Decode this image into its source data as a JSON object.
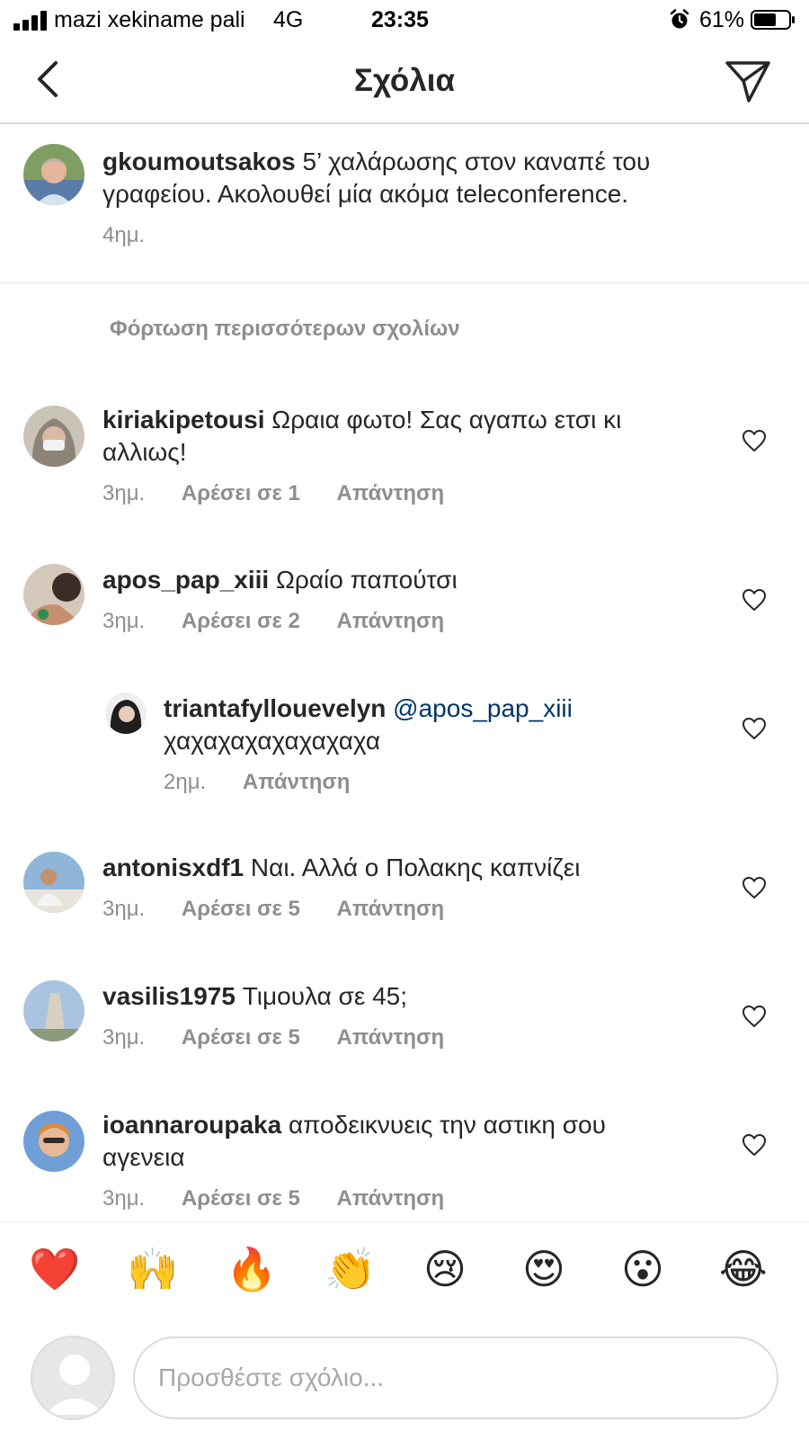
{
  "status_bar": {
    "carrier": "mazi xekiname pali",
    "network": "4G",
    "time": "23:35",
    "battery": "61%"
  },
  "header": {
    "title": "Σχόλια"
  },
  "caption": {
    "username": "gkoumoutsakos",
    "text_line1": " 5’  χαλάρωσης στον καναπέ του",
    "text_line2": "γραφείου. Ακολουθεί μία ακόμα teleconference.",
    "time": "4ημ."
  },
  "load_more": "Φόρτωση περισσότερων σχολίων",
  "comments": [
    {
      "username": "kiriakipetousi",
      "text_line1": " Ωραια φωτο!  Σας αγαπω ετσι κι",
      "text_line2": "αλλιως!",
      "time": "3ημ.",
      "likes": "Αρέσει σε 1",
      "reply": "Απάντηση"
    },
    {
      "username": "apos_pap_xiii",
      "text_line1": " Ωραίο παπούτσι",
      "time": "3ημ.",
      "likes": "Αρέσει σε 2",
      "reply": "Απάντηση"
    },
    {
      "username": "triantafyllouevelyn",
      "mention": " @apos_pap_xiii",
      "text_line2": "χαχαχαχαχαχαχαχα",
      "time": "2ημ.",
      "reply": "Απάντηση"
    },
    {
      "username": "antonisxdf1",
      "text_line1": " Ναι. Αλλά ο Πολακης καπνίζει",
      "time": "3ημ.",
      "likes": "Αρέσει σε 5",
      "reply": "Απάντηση"
    },
    {
      "username": "vasilis1975",
      "text_line1": " Τιμουλα σε 45;",
      "time": "3ημ.",
      "likes": "Αρέσει σε 5",
      "reply": "Απάντηση"
    },
    {
      "username": "ioannaroupaka",
      "text_line1": " αποδεικνυεις την αστικη σου",
      "text_line2": "αγενεια",
      "time": "3ημ.",
      "likes": "Αρέσει σε 5",
      "reply": "Απάντηση"
    }
  ],
  "emoji_bar": [
    "❤️",
    "🙌",
    "🔥",
    "👏",
    "😢",
    "😍",
    "😮",
    "😂"
  ],
  "input": {
    "placeholder": "Προσθέστε σχόλιο..."
  },
  "colors": {
    "text": "#262626",
    "meta": "#8e8e8e",
    "mention": "#003569",
    "divider": "#dbdbdb"
  },
  "icons": [
    "signal-icon",
    "alarm-icon",
    "battery-icon",
    "back-chevron-icon",
    "direct-share-icon",
    "heart-outline-icon",
    "avatar-placeholder-icon"
  ]
}
